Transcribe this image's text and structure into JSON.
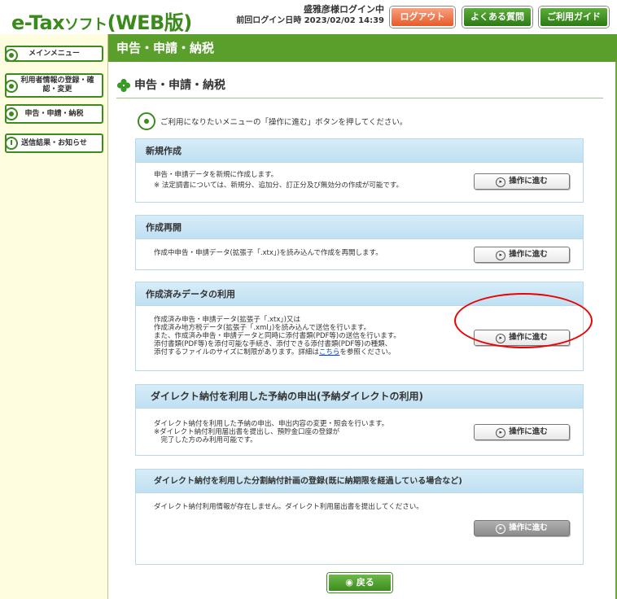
{
  "header": {
    "logo_main": "e-Tax",
    "logo_soft": "ソフト",
    "logo_web": "(WEB版)",
    "user_name": "盛雅彦様ログイン中",
    "last_login_label": "前回ログイン日時",
    "last_login_value": "2023/02/02 14:39",
    "logout": "ログアウト",
    "faq": "よくある質問",
    "guide": "ご利用ガイド"
  },
  "sidebar": {
    "items": [
      {
        "label": "メインメニュー"
      },
      {
        "label": "利用者情報の登録・確認・変更"
      },
      {
        "label": "申告・申請・納税"
      },
      {
        "label": "送信結果・お知らせ"
      }
    ]
  },
  "main": {
    "bar_title": "申告・申請・納税",
    "section_title": "申告・申請・納税",
    "info": "ご利用になりたいメニューの「操作に進む」ボタンを押してください。",
    "proceed_label": "操作に進む",
    "back_label": "戻る",
    "cards": [
      {
        "title": "新規作成",
        "lines": [
          "申告・申請データを新規に作成します。",
          "※ 法定調書については、新規分、追加分、訂正分及び無効分の作成が可能です。"
        ]
      },
      {
        "title": "作成再開",
        "lines": [
          "作成中申告・申請データ(拡張子「.xtx」)を読み込んで作成を再開します。"
        ]
      },
      {
        "title": "作成済みデータの利用",
        "lines": [
          "作成済み申告・申請データ(拡張子「.xtx」)又は",
          "作成済み地方税データ(拡張子「.xml」)を読み込んで送信を行います。",
          "また、作成済み申告・申請データと同時に添付書類(PDF等)の送信を行います。",
          "添付書類(PDF等)を添付可能な手続き、添付できる添付書類(PDF等)の種類、",
          "添付するファイルのサイズに制限があります。詳細は"
        ],
        "link": "こちら",
        "after_link": "を参照ください。"
      },
      {
        "title": "ダイレクト納付を利用した予納の申出(予納ダイレクトの利用)",
        "lines": [
          "ダイレクト納付を利用した予納の申出、申出内容の変更・照会を行います。",
          "※ダイレクト納付利用届出書を提出し、預貯金口座の登録が",
          "　完了した方のみ利用可能です。"
        ]
      },
      {
        "title": "ダイレクト納付を利用した分割納付計画の登録(既に納期限を経過している場合など)",
        "lines": [
          "ダイレクト納付利用情報が存在しません。ダイレクト利用届出書を提出してください。"
        ]
      }
    ]
  }
}
